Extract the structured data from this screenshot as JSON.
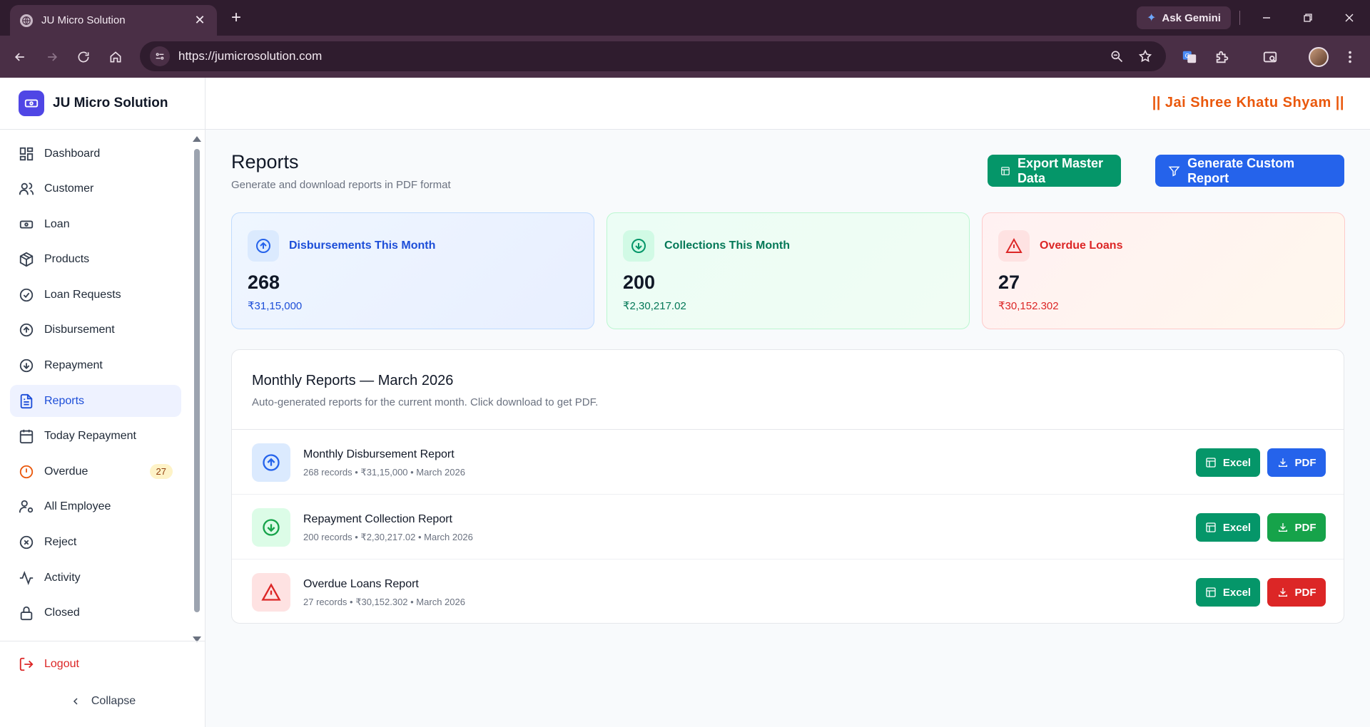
{
  "browser": {
    "tab_title": "JU Micro Solution",
    "url": "https://jumicrosolution.com",
    "gemini_label": "Ask Gemini"
  },
  "app": {
    "name": "JU Micro Solution",
    "tagline": "|| Jai Shree Khatu Shyam ||"
  },
  "sidebar": {
    "items": [
      {
        "label": "Dashboard",
        "icon": "dashboard-icon"
      },
      {
        "label": "Customer",
        "icon": "users-icon"
      },
      {
        "label": "Loan",
        "icon": "banknote-icon"
      },
      {
        "label": "Products",
        "icon": "box-icon"
      },
      {
        "label": "Loan Requests",
        "icon": "check-circle-icon"
      },
      {
        "label": "Disbursement",
        "icon": "arrow-up-circle-icon"
      },
      {
        "label": "Repayment",
        "icon": "arrow-down-circle-icon"
      },
      {
        "label": "Reports",
        "icon": "file-text-icon",
        "active": true
      },
      {
        "label": "Today Repayment",
        "icon": "calendar-icon"
      },
      {
        "label": "Overdue",
        "icon": "alert-circle-icon",
        "badge": "27"
      },
      {
        "label": "All Employee",
        "icon": "user-cog-icon"
      },
      {
        "label": "Reject",
        "icon": "x-circle-icon"
      },
      {
        "label": "Activity",
        "icon": "activity-icon"
      },
      {
        "label": "Closed",
        "icon": "lock-icon"
      }
    ],
    "logout_label": "Logout",
    "collapse_label": "Collapse"
  },
  "page": {
    "title": "Reports",
    "subtitle": "Generate and download reports in PDF format",
    "export_label": "Export Master Data",
    "generate_label": "Generate Custom Report"
  },
  "stats": {
    "disbursements": {
      "label": "Disbursements This Month",
      "count": "268",
      "amount": "₹31,15,000"
    },
    "collections": {
      "label": "Collections This Month",
      "count": "200",
      "amount": "₹2,30,217.02"
    },
    "overdue": {
      "label": "Overdue Loans",
      "count": "27",
      "amount": "₹30,152.302"
    }
  },
  "monthly": {
    "title": "Monthly Reports — March 2026",
    "subtitle": "Auto-generated reports for the current month. Click download to get PDF.",
    "excel_label": "Excel",
    "pdf_label": "PDF",
    "rows": [
      {
        "name": "Monthly Disbursement Report",
        "meta": "268 records • ₹31,15,000 • March 2026",
        "pdf_color": "#2563eb"
      },
      {
        "name": "Repayment Collection Report",
        "meta": "200 records • ₹2,30,217.02 • March 2026",
        "pdf_color": "#16a34a"
      },
      {
        "name": "Overdue Loans Report",
        "meta": "27 records • ₹30,152.302 • March 2026",
        "pdf_color": "#dc2626"
      }
    ]
  },
  "colors": {
    "primary": "#2563eb",
    "success": "#059669",
    "danger": "#dc2626",
    "accent": "#ea580c"
  }
}
